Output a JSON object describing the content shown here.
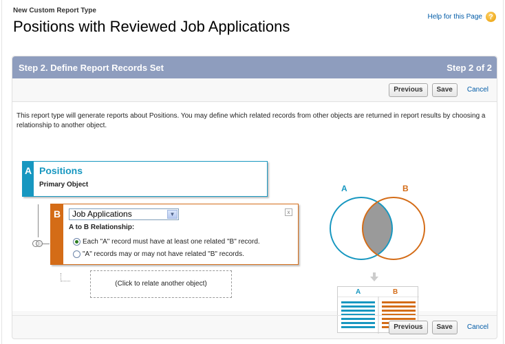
{
  "header": {
    "crumb": "New Custom Report Type",
    "title": "Positions with Reviewed Job Applications",
    "help_link": "Help for this Page"
  },
  "step": {
    "title": "Step 2. Define Report Records Set",
    "counter": "Step 2 of 2"
  },
  "buttons": {
    "previous": "Previous",
    "save": "Save",
    "cancel": "Cancel"
  },
  "description": "This report type will generate reports about Positions. You may define which related records from other objects are returned in report results by choosing a relationship to another object.",
  "object_a": {
    "letter": "A",
    "name": "Positions",
    "subtitle": "Primary Object"
  },
  "object_b": {
    "letter": "B",
    "selected": "Job Applications",
    "relationship_label": "A to B Relationship:",
    "options": [
      {
        "label": "Each \"A\" record must have at least one related \"B\" record.",
        "checked": true
      },
      {
        "label": "\"A\" records may or may not have related \"B\" records.",
        "checked": false
      }
    ]
  },
  "add_object": "(Click to relate another object)",
  "diagram": {
    "label_a": "A",
    "label_b": "B",
    "col_a": "A",
    "col_b": "B"
  },
  "colors": {
    "a": "#1797c0",
    "b": "#d46c17",
    "step_bar": "#8e9dbe"
  }
}
